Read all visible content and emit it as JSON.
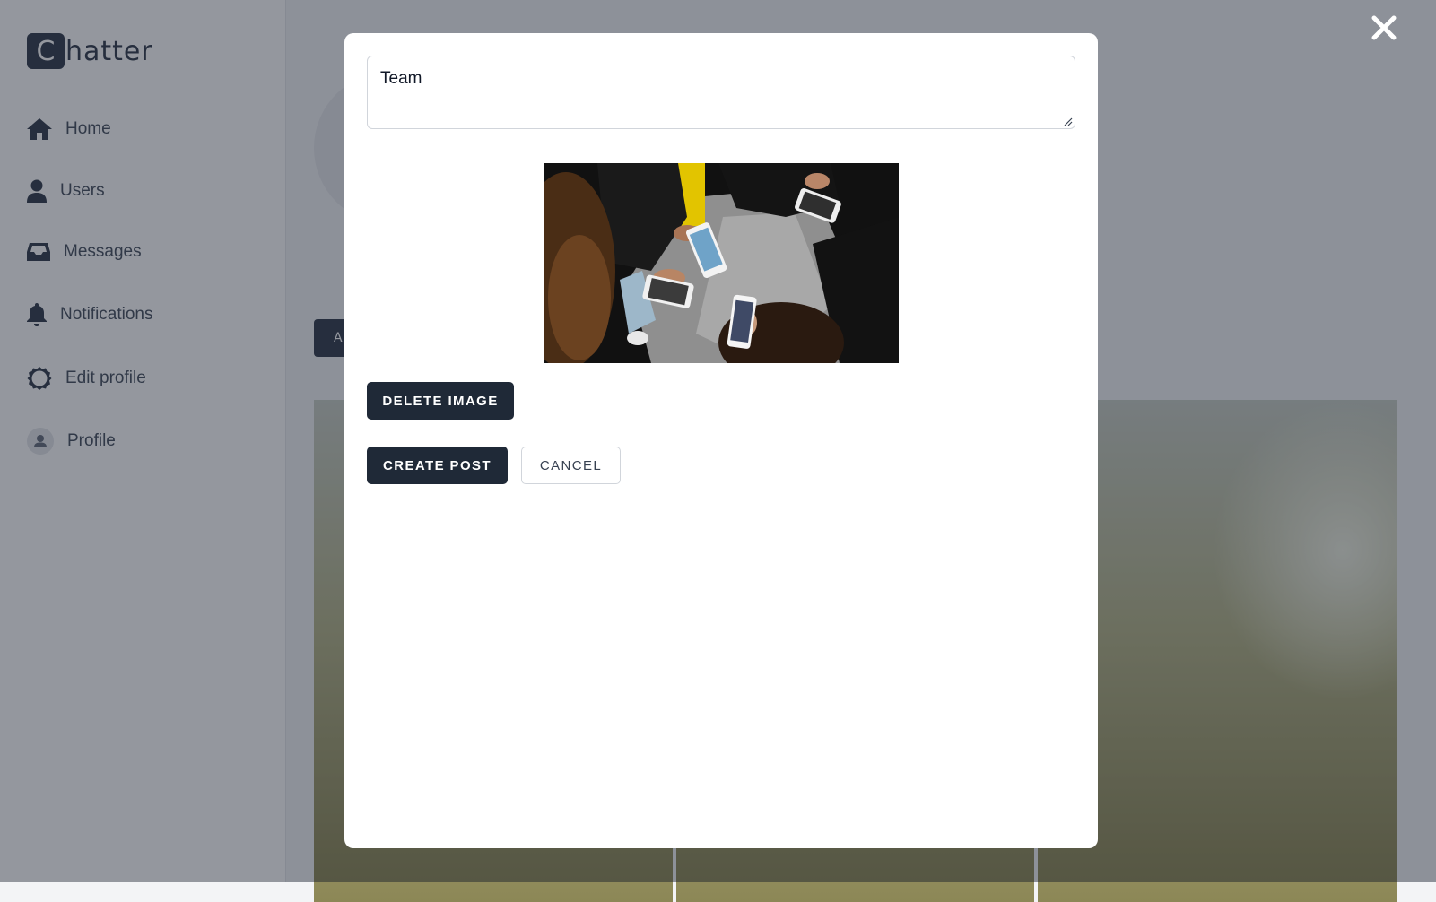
{
  "app": {
    "logo_letter": "C",
    "logo_rest": "hatter"
  },
  "sidebar": {
    "items": [
      {
        "label": "Home",
        "icon": "home-icon"
      },
      {
        "label": "Users",
        "icon": "user-icon"
      },
      {
        "label": "Messages",
        "icon": "inbox-icon"
      },
      {
        "label": "Notifications",
        "icon": "bell-icon"
      },
      {
        "label": "Edit profile",
        "icon": "gear-icon"
      },
      {
        "label": "Profile",
        "icon": "avatar-icon"
      }
    ]
  },
  "background": {
    "tab_partial_label": "A"
  },
  "modal": {
    "post_text": "Team",
    "delete_image_label": "DELETE IMAGE",
    "create_post_label": "CREATE POST",
    "cancel_label": "CANCEL"
  },
  "colors": {
    "primary_dark": "#1f2937",
    "overlay": "rgba(17,24,39,0.45)"
  }
}
